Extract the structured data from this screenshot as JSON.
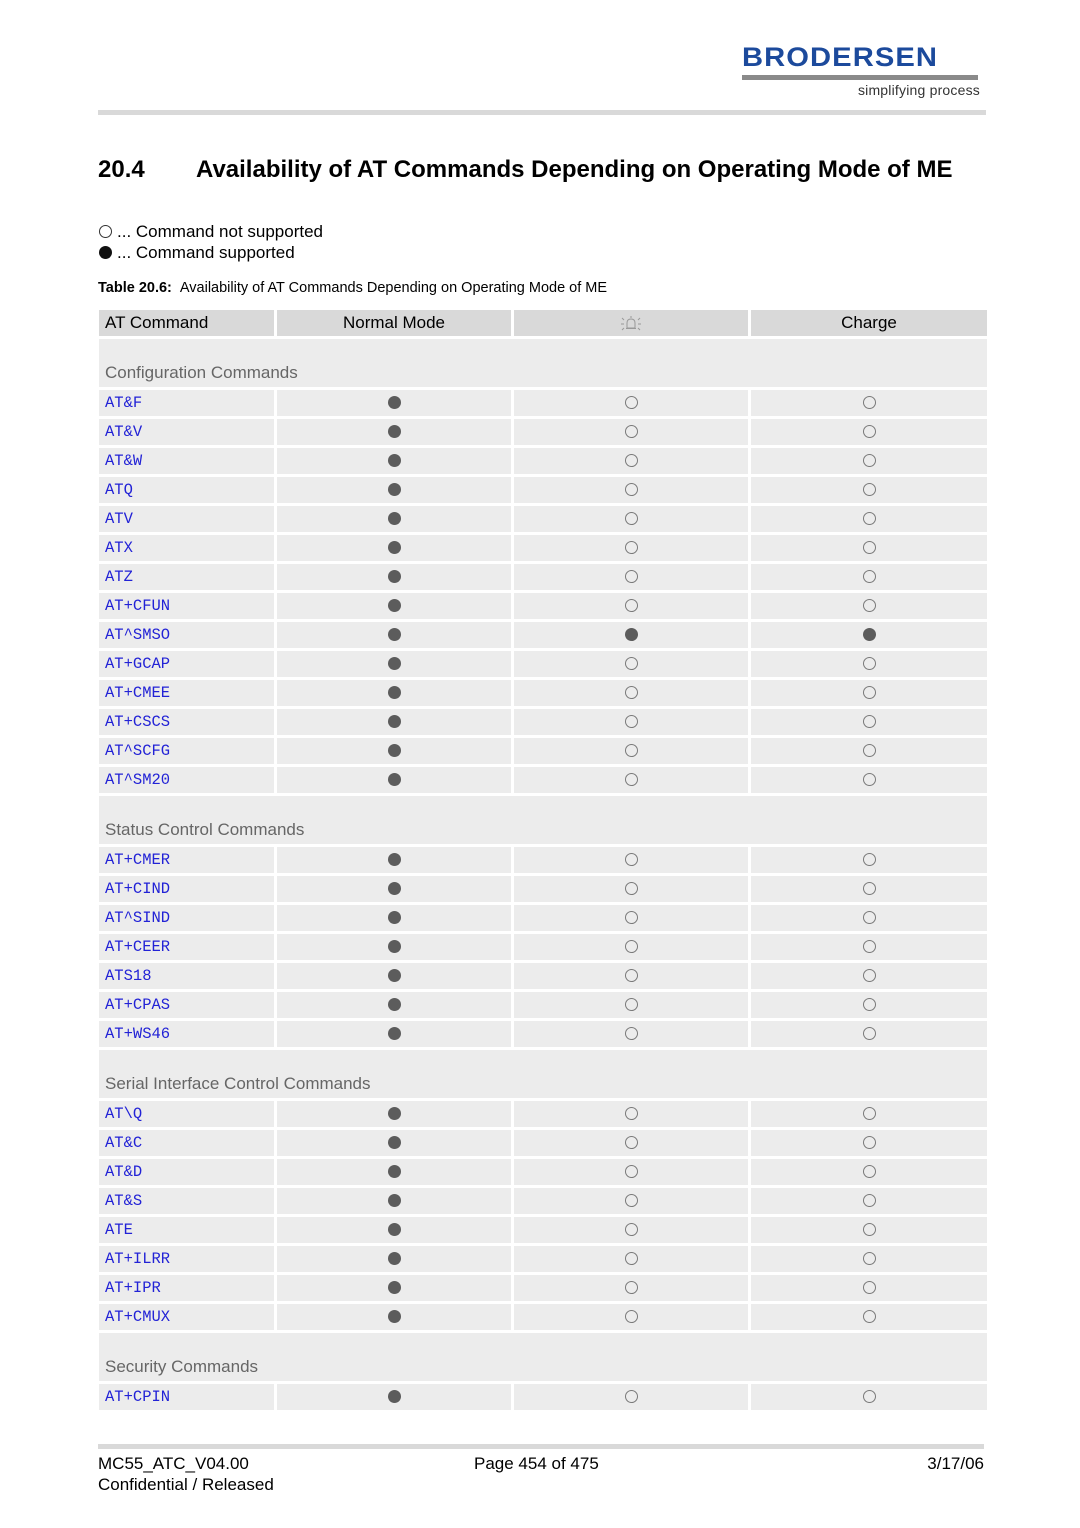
{
  "header": {
    "logo_text": "BRODERSEN",
    "logo_tagline": "simplifying process",
    "brand_color": "#1c4a9c"
  },
  "section": {
    "number": "20.4",
    "title": "Availability of AT Commands Depending on Operating Mode of ME"
  },
  "legend": {
    "not_supported": "... Command not supported",
    "supported": "... Command supported"
  },
  "table": {
    "caption_label": "Table 20.6:",
    "caption_text": "Availability of AT Commands Depending on Operating Mode of ME",
    "columns": [
      "AT Command",
      "Normal Mode",
      "alarm-bell-icon",
      "Charge"
    ],
    "link_color": "#2222d6",
    "groups": [
      {
        "name": "Configuration Commands",
        "rows": [
          {
            "cmd": "AT&F",
            "normal": true,
            "alarm": false,
            "charge": false
          },
          {
            "cmd": "AT&V",
            "normal": true,
            "alarm": false,
            "charge": false
          },
          {
            "cmd": "AT&W",
            "normal": true,
            "alarm": false,
            "charge": false
          },
          {
            "cmd": "ATQ",
            "normal": true,
            "alarm": false,
            "charge": false
          },
          {
            "cmd": "ATV",
            "normal": true,
            "alarm": false,
            "charge": false
          },
          {
            "cmd": "ATX",
            "normal": true,
            "alarm": false,
            "charge": false
          },
          {
            "cmd": "ATZ",
            "normal": true,
            "alarm": false,
            "charge": false
          },
          {
            "cmd": "AT+CFUN",
            "normal": true,
            "alarm": false,
            "charge": false
          },
          {
            "cmd": "AT^SMSO",
            "normal": true,
            "alarm": true,
            "charge": true
          },
          {
            "cmd": "AT+GCAP",
            "normal": true,
            "alarm": false,
            "charge": false
          },
          {
            "cmd": "AT+CMEE",
            "normal": true,
            "alarm": false,
            "charge": false
          },
          {
            "cmd": "AT+CSCS",
            "normal": true,
            "alarm": false,
            "charge": false
          },
          {
            "cmd": "AT^SCFG",
            "normal": true,
            "alarm": false,
            "charge": false
          },
          {
            "cmd": "AT^SM20",
            "normal": true,
            "alarm": false,
            "charge": false
          }
        ]
      },
      {
        "name": "Status Control Commands",
        "rows": [
          {
            "cmd": "AT+CMER",
            "normal": true,
            "alarm": false,
            "charge": false
          },
          {
            "cmd": "AT+CIND",
            "normal": true,
            "alarm": false,
            "charge": false
          },
          {
            "cmd": "AT^SIND",
            "normal": true,
            "alarm": false,
            "charge": false
          },
          {
            "cmd": "AT+CEER",
            "normal": true,
            "alarm": false,
            "charge": false
          },
          {
            "cmd": "ATS18",
            "normal": true,
            "alarm": false,
            "charge": false
          },
          {
            "cmd": "AT+CPAS",
            "normal": true,
            "alarm": false,
            "charge": false
          },
          {
            "cmd": "AT+WS46",
            "normal": true,
            "alarm": false,
            "charge": false
          }
        ]
      },
      {
        "name": "Serial Interface Control Commands",
        "rows": [
          {
            "cmd": "AT\\Q",
            "normal": true,
            "alarm": false,
            "charge": false
          },
          {
            "cmd": "AT&C",
            "normal": true,
            "alarm": false,
            "charge": false
          },
          {
            "cmd": "AT&D",
            "normal": true,
            "alarm": false,
            "charge": false
          },
          {
            "cmd": "AT&S",
            "normal": true,
            "alarm": false,
            "charge": false
          },
          {
            "cmd": "ATE",
            "normal": true,
            "alarm": false,
            "charge": false
          },
          {
            "cmd": "AT+ILRR",
            "normal": true,
            "alarm": false,
            "charge": false
          },
          {
            "cmd": "AT+IPR",
            "normal": true,
            "alarm": false,
            "charge": false
          },
          {
            "cmd": "AT+CMUX",
            "normal": true,
            "alarm": false,
            "charge": false
          }
        ]
      },
      {
        "name": "Security Commands",
        "rows": [
          {
            "cmd": "AT+CPIN",
            "normal": true,
            "alarm": false,
            "charge": false
          }
        ]
      }
    ]
  },
  "footer": {
    "doc_id": "MC55_ATC_V04.00",
    "status": "Confidential / Released",
    "page": "Page 454 of 475",
    "date": "3/17/06"
  }
}
